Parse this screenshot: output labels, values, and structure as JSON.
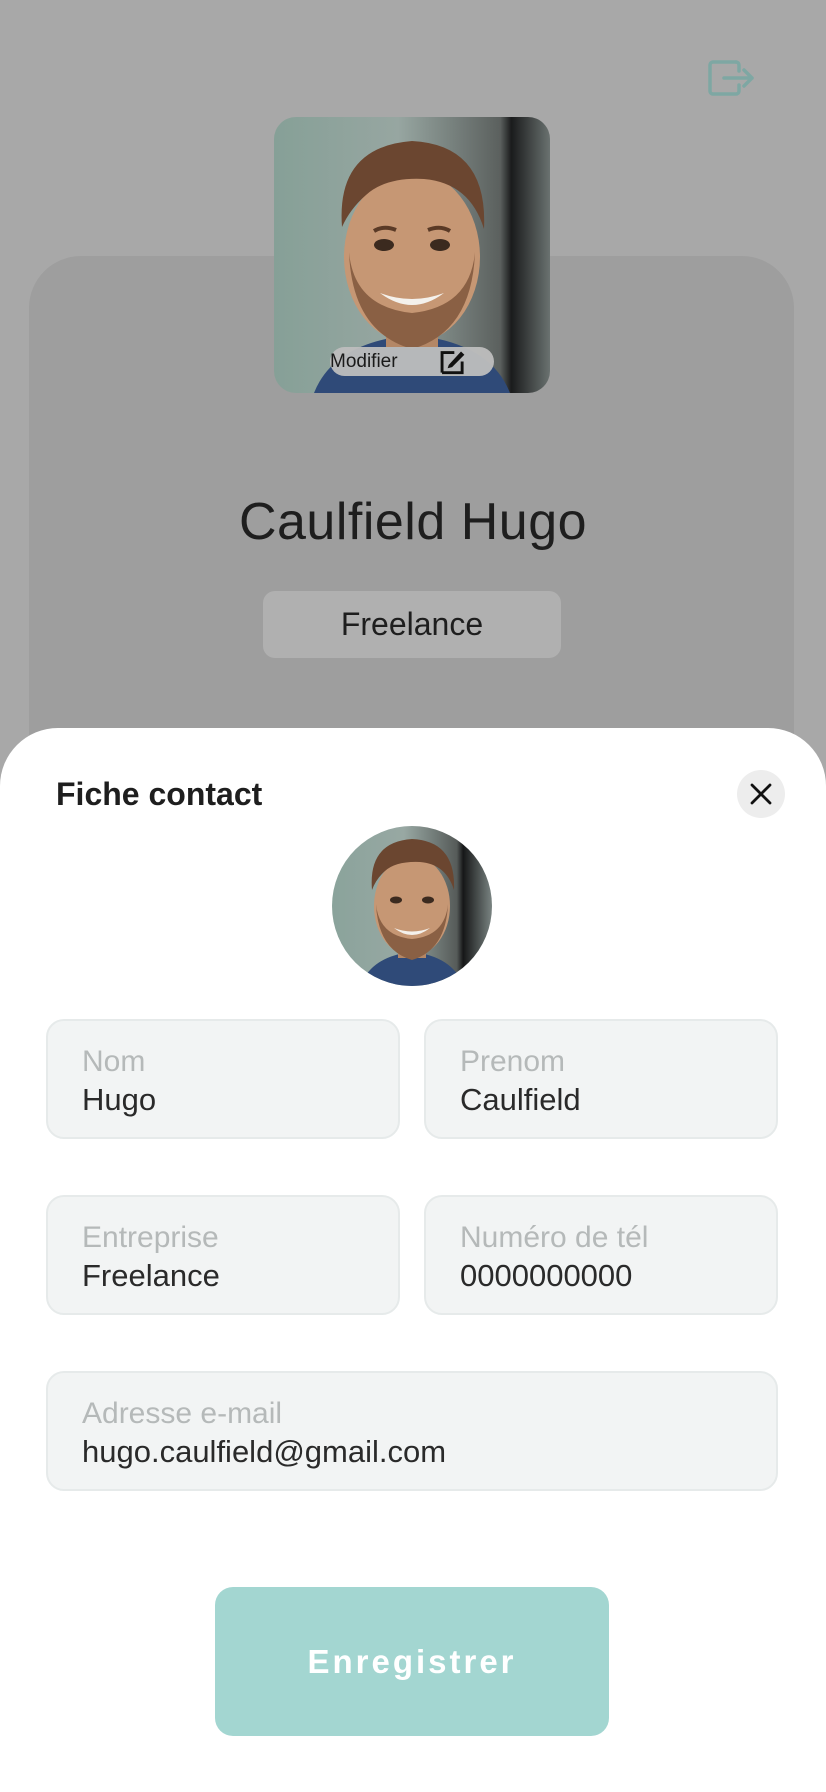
{
  "profile": {
    "photo_action_label": "Modifier",
    "name": "Caulfield Hugo",
    "company_badge": "Freelance"
  },
  "sheet": {
    "title": "Fiche contact",
    "fields": {
      "last_name": {
        "label": "Nom",
        "value": "Hugo"
      },
      "first_name": {
        "label": "Prenom",
        "value": "Caulfield"
      },
      "company": {
        "label": "Entreprise",
        "value": "Freelance"
      },
      "phone": {
        "label": "Numéro de tél",
        "value": "0000000000"
      },
      "email": {
        "label": "Adresse e-mail",
        "value": "hugo.caulfield@gmail.com"
      }
    },
    "save_label": "Enregistrer"
  },
  "icons": {
    "logout": "logout-icon",
    "edit": "edit-icon",
    "close": "close-icon"
  },
  "colors": {
    "accent": "#a3d6d1",
    "overlay": "#a8a8a8",
    "field_bg": "#f2f4f4"
  }
}
